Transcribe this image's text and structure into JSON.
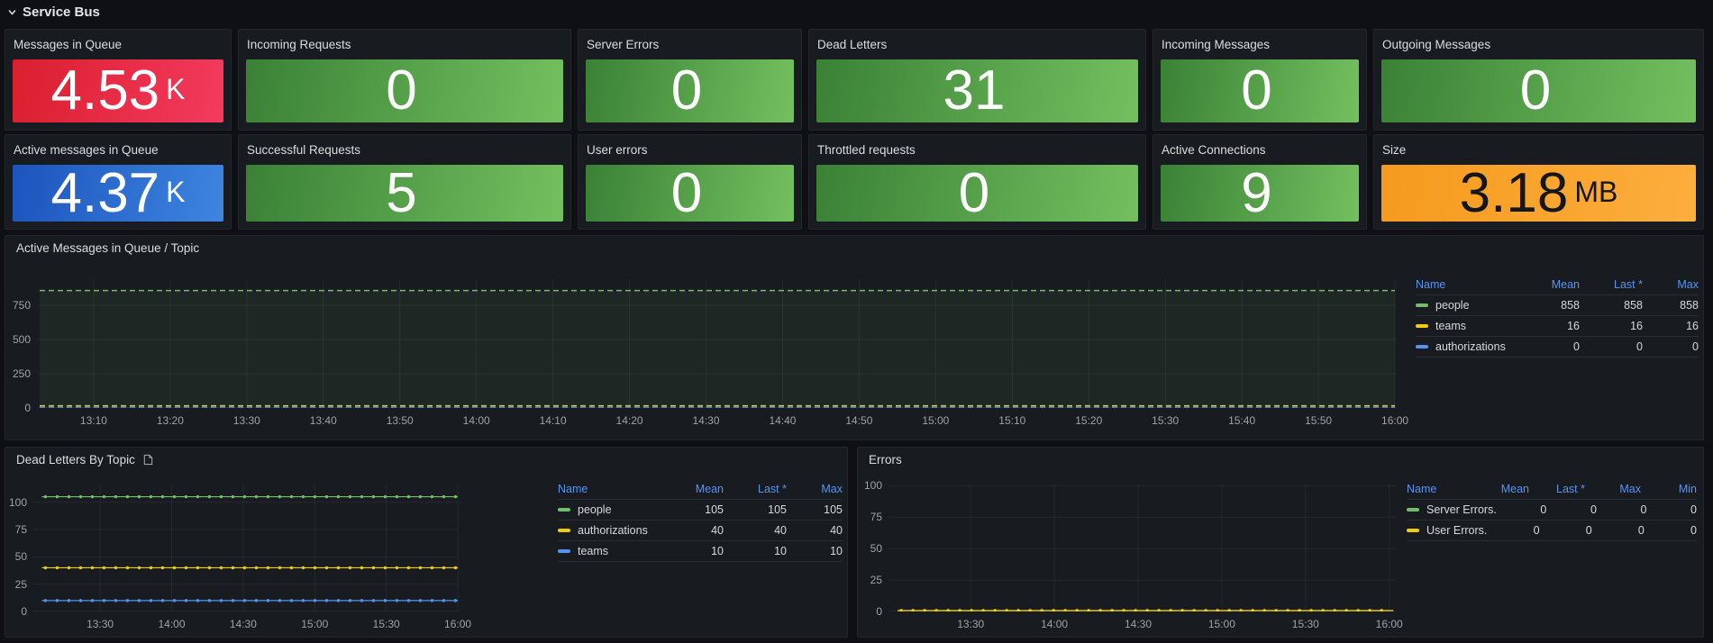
{
  "header": {
    "title": "Service Bus",
    "collapse_icon": "chevron-down"
  },
  "colors": {
    "page_bg": "#0e1013",
    "panel_bg": "#181b1f",
    "stat_red": "#e02f44",
    "stat_green": "#56a64b",
    "stat_blue": "#3274d9",
    "stat_orange": "#f5a623",
    "series_green": "#73BF69",
    "series_yellow": "#F2CC0C",
    "series_blue": "#5794F2",
    "legend_header": "#5794F2"
  },
  "stats": {
    "row1": [
      {
        "title": "Messages in Queue",
        "value": "4.53",
        "unit": "K",
        "color": "red"
      },
      {
        "title": "Incoming Requests",
        "value": "0",
        "unit": "",
        "color": "green"
      },
      {
        "title": "Server Errors",
        "value": "0",
        "unit": "",
        "color": "green"
      },
      {
        "title": "Dead Letters",
        "value": "31",
        "unit": "",
        "color": "green"
      },
      {
        "title": "Incoming Messages",
        "value": "0",
        "unit": "",
        "color": "green"
      },
      {
        "title": "Outgoing Messages",
        "value": "0",
        "unit": "",
        "color": "green"
      }
    ],
    "row2": [
      {
        "title": "Active messages in Queue",
        "value": "4.37",
        "unit": "K",
        "color": "blue"
      },
      {
        "title": "Successful Requests",
        "value": "5",
        "unit": "",
        "color": "green"
      },
      {
        "title": "User errors",
        "value": "0",
        "unit": "",
        "color": "green"
      },
      {
        "title": "Throttled requests",
        "value": "0",
        "unit": "",
        "color": "green"
      },
      {
        "title": "Active Connections",
        "value": "9",
        "unit": "",
        "color": "green"
      },
      {
        "title": "Size",
        "value": "3.18",
        "unit": "MB",
        "color": "orange"
      }
    ]
  },
  "chart_data": [
    {
      "type": "line",
      "title": "Active Messages in Queue / Topic",
      "x_ticks": [
        "13:10",
        "13:20",
        "13:30",
        "13:40",
        "13:50",
        "14:00",
        "14:10",
        "14:20",
        "14:30",
        "14:40",
        "14:50",
        "15:00",
        "15:10",
        "15:20",
        "15:30",
        "15:40",
        "15:50",
        "16:00"
      ],
      "y_ticks": [
        0,
        250,
        500,
        750
      ],
      "ylim": [
        0,
        941
      ],
      "grid": true,
      "legend_position": "right-table",
      "series": [
        {
          "name": "people",
          "color": "#73BF69",
          "value": 858,
          "fill": true
        },
        {
          "name": "teams",
          "color": "#F2CC0C",
          "value": 16
        },
        {
          "name": "authorizations",
          "color": "#5794F2",
          "value": 0
        }
      ],
      "legend": {
        "columns": [
          "Name",
          "Mean",
          "Last *",
          "Max"
        ],
        "rows": [
          [
            "people",
            "858",
            "858",
            "858"
          ],
          [
            "teams",
            "16",
            "16",
            "16"
          ],
          [
            "authorizations",
            "0",
            "0",
            "0"
          ]
        ]
      }
    },
    {
      "type": "line",
      "title": "Dead Letters By Topic",
      "x_ticks": [
        "13:30",
        "14:00",
        "14:30",
        "15:00",
        "15:30",
        "16:00"
      ],
      "y_ticks": [
        0,
        25,
        50,
        75,
        100
      ],
      "ylim": [
        0,
        117
      ],
      "grid": true,
      "legend_position": "right-table",
      "series": [
        {
          "name": "people",
          "color": "#73BF69",
          "value": 105
        },
        {
          "name": "authorizations",
          "color": "#F2CC0C",
          "value": 40
        },
        {
          "name": "teams",
          "color": "#5794F2",
          "value": 10
        }
      ],
      "legend": {
        "columns": [
          "Name",
          "Mean",
          "Last *",
          "Max"
        ],
        "rows": [
          [
            "people",
            "105",
            "105",
            "105"
          ],
          [
            "authorizations",
            "40",
            "40",
            "40"
          ],
          [
            "teams",
            "10",
            "10",
            "10"
          ]
        ]
      }
    },
    {
      "type": "line",
      "title": "Errors",
      "x_ticks": [
        "13:30",
        "14:00",
        "14:30",
        "15:00",
        "15:30",
        "16:00"
      ],
      "y_ticks": [
        0,
        25,
        50,
        75,
        100
      ],
      "ylim": [
        0,
        101
      ],
      "grid": true,
      "legend_position": "right-table",
      "series": [
        {
          "name": "Server Errors.",
          "color": "#73BF69",
          "value": 0
        },
        {
          "name": "User Errors.",
          "color": "#F2CC0C",
          "value": 0
        }
      ],
      "legend": {
        "columns": [
          "Name",
          "Mean",
          "Last *",
          "Max",
          "Min"
        ],
        "rows": [
          [
            "Server Errors.",
            "0",
            "0",
            "0",
            "0"
          ],
          [
            "User Errors.",
            "0",
            "0",
            "0",
            "0"
          ]
        ]
      }
    }
  ]
}
